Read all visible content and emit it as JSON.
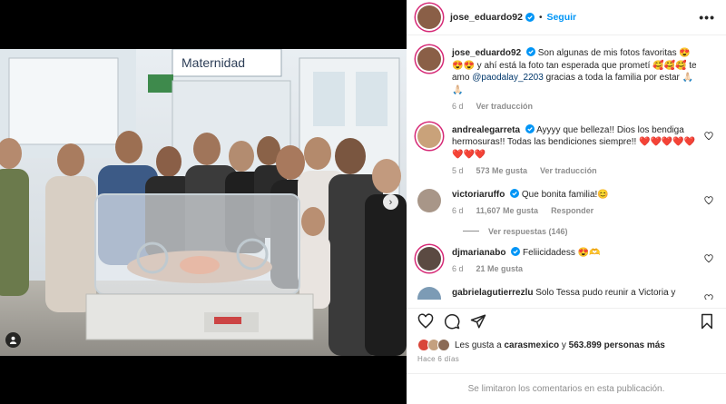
{
  "header": {
    "username": "jose_eduardo92",
    "follow_label": "Seguir",
    "more": "•••"
  },
  "caption": {
    "username": "jose_eduardo92",
    "text_1": "Son algunas de mis fotos favoritas 😍😍😍 y ahí está la foto tan esperada que prometí 🥰🥰🥰 te amo",
    "mention": "@paodalay_2203",
    "text_2": "gracias a toda la familia por estar 🙏🏻🙏🏻",
    "time": "6 d",
    "translate": "Ver traducción"
  },
  "comments": [
    {
      "username": "andrealegarreta",
      "text": "Ayyyy que belleza!! Dios los bendiga hermosuras!! Todas las bendiciones siempre!! ❤️❤️❤️❤️❤️❤️❤️❤️",
      "time": "5 d",
      "likes": "573 Me gusta",
      "translate": "Ver traducción"
    },
    {
      "username": "victoriaruffo",
      "text": "Que bonita familia!😊",
      "time": "6 d",
      "likes": "11,607 Me gusta",
      "reply": "Responder",
      "view_replies": "Ver respuestas (146)"
    },
    {
      "username": "djmarianabo",
      "text": "Feliicidadess 😍🫶",
      "time": "6 d",
      "likes": "21 Me gusta"
    },
    {
      "username": "gabrielagutierrezlu",
      "text": "Solo Tessa pudo reunir a Victoria y"
    }
  ],
  "likes_line": {
    "prefix": "Les gusta a",
    "user": "carasmexico",
    "middle": "y",
    "count": "563.899 personas más"
  },
  "posted_ago": "Hace 6 días",
  "comments_limited": "Se limitaron los comentarios en esta publicación.",
  "photo": {
    "sign_text": "Maternidad"
  },
  "colors": {
    "accent": "#0095f6",
    "verified": "#0095f6",
    "mention": "#00376b",
    "muted": "#8e8e8e"
  }
}
